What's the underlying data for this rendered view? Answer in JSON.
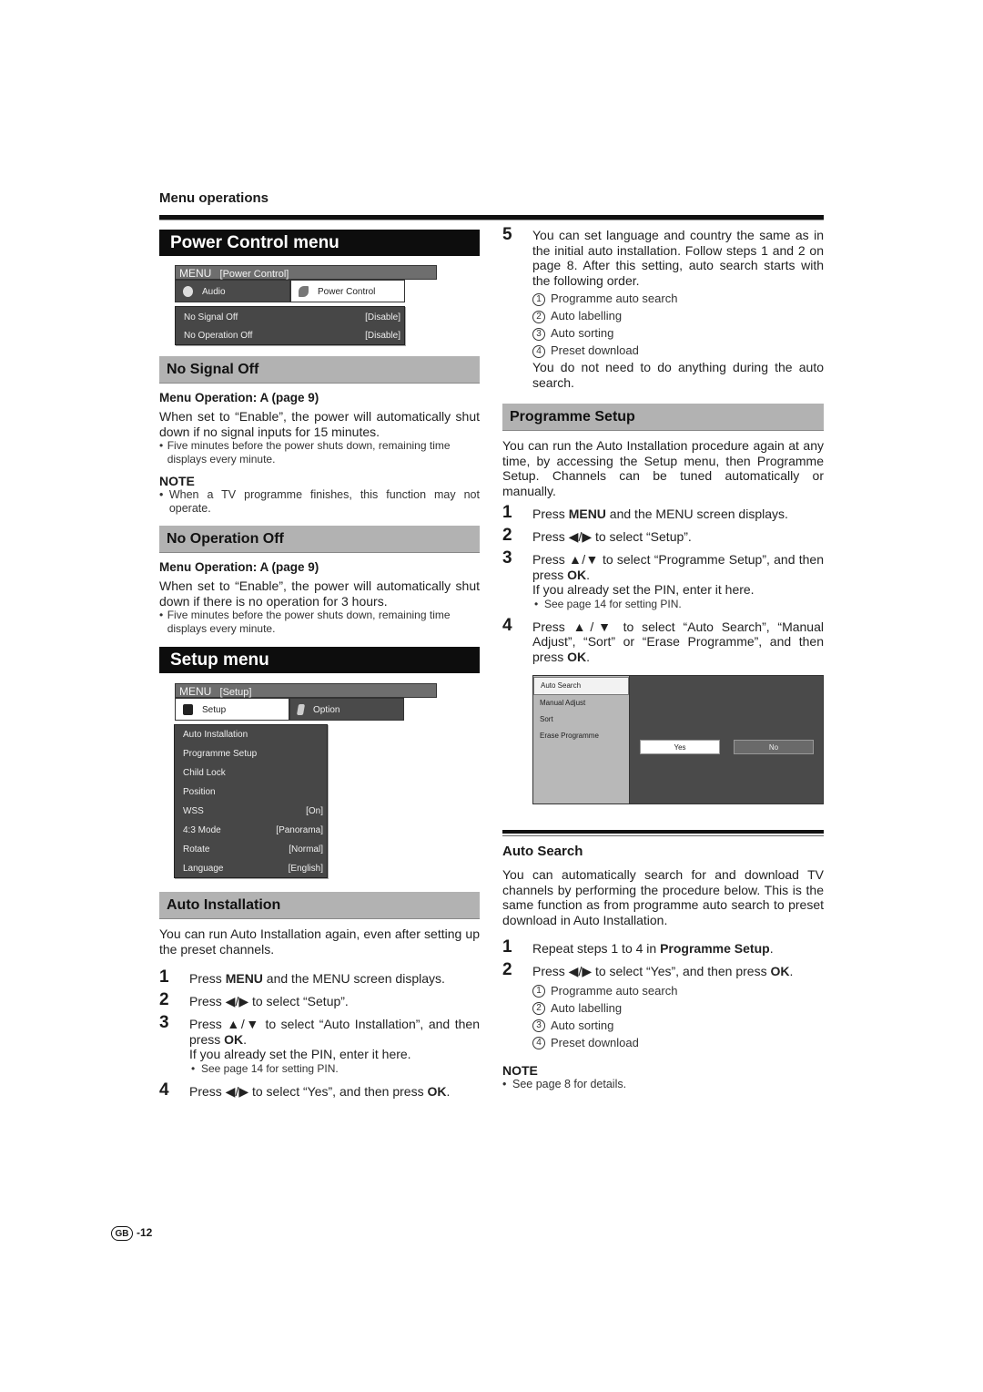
{
  "header": {
    "section": "Menu operations"
  },
  "left": {
    "power_control": {
      "title": "Power Control menu",
      "menu": {
        "bar_menu": "MENU",
        "bar_path": "[Power Control]",
        "tabs": [
          {
            "label": "Audio",
            "icon": "speaker-icon",
            "active": false
          },
          {
            "label": "Power Control",
            "icon": "leaf-icon",
            "active": true
          }
        ],
        "items": [
          {
            "label": "No Signal Off",
            "value": "[Disable]"
          },
          {
            "label": "No Operation Off",
            "value": "[Disable]"
          }
        ]
      }
    },
    "no_signal_off": {
      "title": "No Signal Off",
      "op": "Menu Operation: A (page 9)",
      "body": "When set to “Enable”, the power will automatically shut down if no signal inputs for 15 minutes.",
      "bullet": "Five minutes before the power shuts down, remaining time displays every minute.",
      "note_heading": "NOTE",
      "note": "When a TV programme finishes, this function may not operate."
    },
    "no_operation_off": {
      "title": "No Operation Off",
      "op": "Menu Operation: A (page 9)",
      "body": "When set to “Enable”, the power will automatically shut down if there is no operation for 3 hours.",
      "bullet": "Five minutes before the power shuts down, remaining time displays every minute."
    },
    "setup_menu": {
      "title": "Setup menu",
      "menu": {
        "bar_menu": "MENU",
        "bar_path": "[Setup]",
        "tabs": [
          {
            "label": "Setup",
            "icon": "setup-icon",
            "active": true
          },
          {
            "label": "Option",
            "icon": "option-icon",
            "active": false
          }
        ],
        "items": [
          {
            "label": "Auto Installation",
            "value": ""
          },
          {
            "label": "Programme Setup",
            "value": ""
          },
          {
            "label": "Child Lock",
            "value": ""
          },
          {
            "label": "Position",
            "value": ""
          },
          {
            "label": "WSS",
            "value": "[On]"
          },
          {
            "label": "4:3 Mode",
            "value": "[Panorama]"
          },
          {
            "label": "Rotate",
            "value": "[Normal]"
          },
          {
            "label": "Language",
            "value": "[English]"
          }
        ]
      }
    },
    "auto_installation": {
      "title": "Auto Installation",
      "intro": "You can run Auto Installation again, even after setting up the preset channels.",
      "steps": [
        {
          "num": "1",
          "pre": "Press ",
          "bold": "MENU",
          "post": " and the MENU screen displays."
        },
        {
          "num": "2",
          "text": "Press ◀/▶ to select “Setup”."
        },
        {
          "num": "3",
          "pre": "Press ▲/▼ to select “Auto Installation”, and then press ",
          "bold": "OK",
          "post": ".",
          "line2": "If you already set the PIN, enter it here.",
          "bullet": "See page 14 for setting PIN."
        },
        {
          "num": "4",
          "pre": "Press ◀/▶ to select “Yes”, and then press ",
          "bold": "OK",
          "post": "."
        }
      ]
    }
  },
  "right": {
    "step5": {
      "num": "5",
      "text": "You can set language and country the same as in the initial auto installation. Follow steps 1 and 2 on page 8. After this setting, auto search starts with the following order.",
      "order": [
        {
          "n": "1",
          "label": "Programme auto search"
        },
        {
          "n": "2",
          "label": "Auto labelling"
        },
        {
          "n": "3",
          "label": "Auto sorting"
        },
        {
          "n": "4",
          "label": "Preset download"
        }
      ],
      "after": "You do not need to do anything during the auto search."
    },
    "programme_setup": {
      "title": "Programme Setup",
      "intro": "You can run the Auto Installation procedure again at any time, by accessing the Setup menu, then Programme Setup. Channels can be tuned automatically or manually.",
      "steps": [
        {
          "num": "1",
          "pre": "Press ",
          "bold": "MENU",
          "post": " and the MENU screen displays."
        },
        {
          "num": "2",
          "text": "Press ◀/▶ to select “Setup”."
        },
        {
          "num": "3",
          "pre": "Press ▲/▼ to select “Programme Setup”, and then press ",
          "bold": "OK",
          "post": ".",
          "line2": "If you already set the PIN, enter it here.",
          "bullet": "See page 14 for setting PIN."
        },
        {
          "num": "4",
          "pre": "Press ▲/▼ to select “Auto Search”, “Manual Adjust”, “Sort” or “Erase Programme”, and then press ",
          "bold": "OK",
          "post": "."
        }
      ],
      "screen": {
        "items": [
          "Auto Search",
          "Manual Adjust",
          "Sort",
          "Erase Programme"
        ],
        "selected": "Auto Search",
        "yes": "Yes",
        "no": "No"
      }
    },
    "auto_search": {
      "title": "Auto Search",
      "intro": "You can automatically search for and download TV channels  by performing the procedure below. This is the same function as from programme auto search to preset download in Auto Installation.",
      "steps": [
        {
          "num": "1",
          "pre": "Repeat steps 1 to 4 in ",
          "bold": "Programme Setup",
          "post": "."
        },
        {
          "num": "2",
          "pre": "Press ◀/▶ to select “Yes”, and then press ",
          "bold": "OK",
          "post": "."
        }
      ],
      "order": [
        {
          "n": "1",
          "label": "Programme auto search"
        },
        {
          "n": "2",
          "label": "Auto labelling"
        },
        {
          "n": "3",
          "label": "Auto sorting"
        },
        {
          "n": "4",
          "label": "Preset download"
        }
      ],
      "note_heading": "NOTE",
      "note": "See page 8 for details."
    }
  },
  "footer": {
    "region": "GB",
    "page": "-12"
  }
}
